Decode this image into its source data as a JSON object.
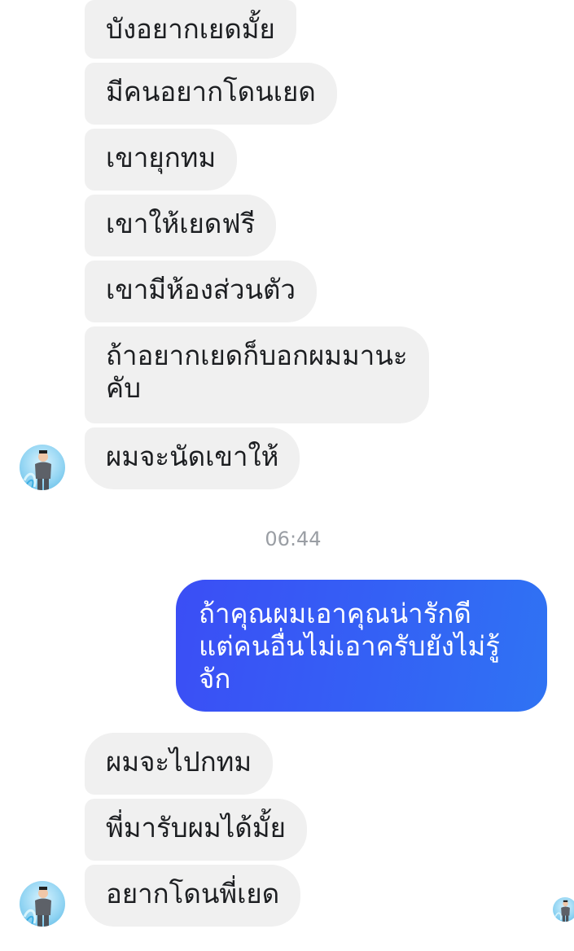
{
  "conversation": {
    "incoming_group_1": [
      "บังอยากเยดมั้ย",
      "มีคนอยากโดนเยด",
      "เขายุกทม",
      "เขาให้เยดฟรี",
      "เขามีห้องส่วนตัว",
      "ถ้าอยากเยดก็บอกผมมานะ\nคับ",
      "ผมจะนัดเขาให้"
    ],
    "timestamp": "06:44",
    "outgoing": "ถ้าคุณผมเอาคุณน่ารักดี\nแต่คนอื่นไม่เอาครับยังไม่รู้\nจัก",
    "incoming_group_2": [
      "ผมจะไปกทม",
      "พี่มารับผมได้มั้ย",
      "อยากโดนพี่เยด"
    ]
  },
  "colors": {
    "incoming_bubble": "#f0f0f0",
    "outgoing_bubble": "#3461f5",
    "timestamp_text": "#9a9ea4"
  },
  "icons": {
    "contact_avatar": "person-avatar-icon",
    "read_receipt": "read-receipt-avatar-icon"
  }
}
